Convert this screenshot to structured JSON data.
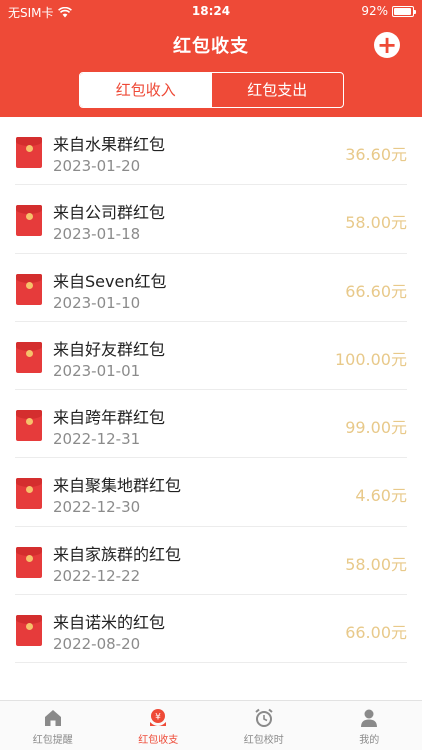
{
  "status": {
    "carrier": "无SIM卡",
    "time": "18:24",
    "battery": "92%",
    "battery_level": 0.92
  },
  "header": {
    "title": "红包收支"
  },
  "segments": [
    {
      "label": "红包收入",
      "active": true
    },
    {
      "label": "红包支出",
      "active": false
    }
  ],
  "records": [
    {
      "title": "来自水果群红包",
      "date": "2023-01-20",
      "amount": "36.60元"
    },
    {
      "title": "来自公司群红包",
      "date": "2023-01-18",
      "amount": "58.00元"
    },
    {
      "title": "来自Seven红包",
      "date": "2023-01-10",
      "amount": "66.60元"
    },
    {
      "title": "来自好友群红包",
      "date": "2023-01-01",
      "amount": "100.00元"
    },
    {
      "title": "来自跨年群红包",
      "date": "2022-12-31",
      "amount": "99.00元"
    },
    {
      "title": "来自聚集地群红包",
      "date": "2022-12-30",
      "amount": "4.60元"
    },
    {
      "title": "来自家族群的红包",
      "date": "2022-12-22",
      "amount": "58.00元"
    },
    {
      "title": "来自诺米的红包",
      "date": "2022-08-20",
      "amount": "66.00元"
    }
  ],
  "tabbar": [
    {
      "label": "红包提醒",
      "icon": "home-icon",
      "active": false
    },
    {
      "label": "红包收支",
      "icon": "red-packet-icon",
      "active": true
    },
    {
      "label": "红包校时",
      "icon": "alarm-clock-icon",
      "active": false
    },
    {
      "label": "我的",
      "icon": "person-icon",
      "active": false
    }
  ],
  "colors": {
    "brand": "#ee4a37",
    "amount": "#e8c98a"
  }
}
